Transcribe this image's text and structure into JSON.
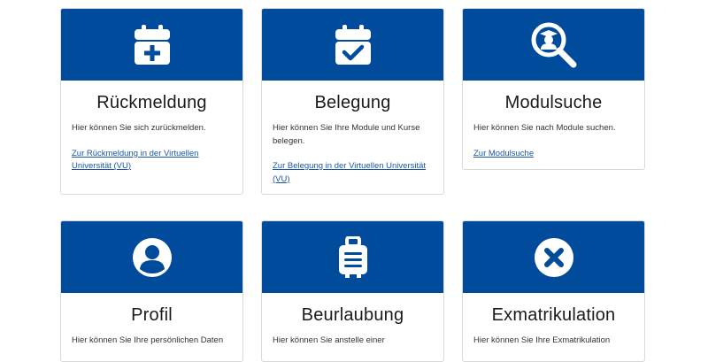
{
  "colors": {
    "banner": "#004b9b",
    "link": "#1a56a8"
  },
  "cards": [
    {
      "icon": "calendar-plus-icon",
      "title": "Rückmeldung",
      "description": "Hier können Sie sich zurückmelden.",
      "link": "Zur Rückmeldung in der Virtuellen Universität (VU)"
    },
    {
      "icon": "calendar-check-icon",
      "title": "Belegung",
      "description": "Hier können Sie Ihre Module und Kurse belegen.",
      "link": "Zur Belegung in der Virtuellen Universität (VU)"
    },
    {
      "icon": "search-graduate-icon",
      "title": "Modulsuche",
      "description": "Hier können Sie nach Module suchen.",
      "link": "Zur Modulsuche"
    },
    {
      "icon": "user-circle-icon",
      "title": "Profil",
      "description": "Hier können Sie Ihre persönlichen Daten"
    },
    {
      "icon": "suitcase-icon",
      "title": "Beurlaubung",
      "description": "Hier können Sie anstelle einer"
    },
    {
      "icon": "x-circle-icon",
      "title": "Exmatrikulation",
      "description": "Hier können Sie Ihre Exmatrikulation"
    }
  ]
}
